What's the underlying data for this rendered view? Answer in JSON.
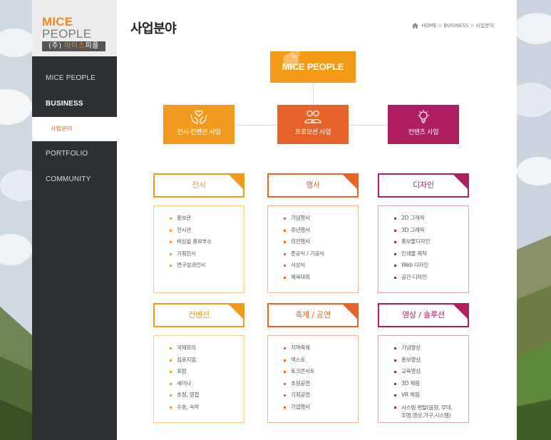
{
  "brand": {
    "logo_mice": "MICE",
    "logo_people": "PEOPLE",
    "logo_sub_prefix": "(주)",
    "logo_sub_highlight": "마이스",
    "logo_sub_suffix": "피플"
  },
  "sidebar": {
    "items": [
      {
        "label": "MICE PEOPLE"
      },
      {
        "label": "BUSINESS"
      },
      {
        "label": "사업분야"
      },
      {
        "label": "PORTFOLIO"
      },
      {
        "label": "COMMUNITY"
      }
    ]
  },
  "page": {
    "title": "사업분야",
    "breadcrumb": [
      "HOME",
      "BUSINESS",
      "사업분야"
    ]
  },
  "org": {
    "root": "MICE PEOPLE",
    "categories": [
      {
        "label": "전시·컨벤션 사업",
        "icon": "hands-heart-icon"
      },
      {
        "label": "프로모션 사업",
        "icon": "people-icon"
      },
      {
        "label": "컨텐츠 사업",
        "icon": "lightbulb-icon"
      }
    ]
  },
  "sections": [
    {
      "title": "전시",
      "items": [
        "홍보관",
        "전시관",
        "비상설 홍보부스",
        "기획전시",
        "연구성과전시"
      ]
    },
    {
      "title": "행사",
      "items": [
        "기념행사",
        "주년행사",
        "의전행사",
        "준공식 / 기공식",
        "시상식",
        "체육대회"
      ]
    },
    {
      "title": "디자인",
      "items": [
        "2D 그래픽",
        "3D 그래픽",
        "홍보물디자인",
        "인쇄물 제작",
        "Web 디자인",
        "공간 디자인"
      ]
    },
    {
      "title": "컨벤션",
      "items": [
        "국제회의",
        "심포지엄",
        "포럼",
        "세미나",
        "초청, 영접",
        "수송, 숙박"
      ]
    },
    {
      "title": "축제 / 공연",
      "items": [
        "지역축제",
        "엑스포",
        "토크콘서트",
        "초청공연",
        "기획공연",
        "기업행사"
      ]
    },
    {
      "title": "영상 / 솔루션",
      "items": [
        "기념영상",
        "홍보영상",
        "교육영상",
        "3D 체험",
        "VR 체험",
        "시스템 렌탈(음향, 무대,",
        "조명,영상,가구,시스템)"
      ]
    }
  ],
  "colors": {
    "orange": "#f29a1d",
    "red_orange": "#e8632a",
    "magenta": "#b01e62",
    "sidebar": "#2d3033"
  }
}
